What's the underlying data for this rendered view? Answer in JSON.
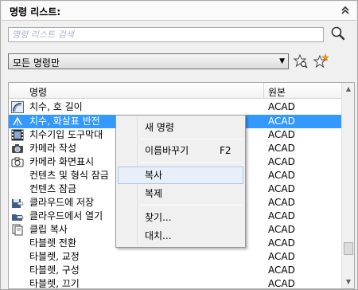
{
  "panel": {
    "title": "명령 리스트:",
    "collapse_icon": "double-chevron-up"
  },
  "search": {
    "placeholder": "명령 리스트 검색",
    "icon": "magnifier"
  },
  "filter": {
    "selected": "모든 명령만",
    "icons": [
      "find-star",
      "new-star"
    ]
  },
  "list": {
    "columns": [
      "명령",
      "원본"
    ],
    "rows": [
      {
        "name": "치수, 호 길이",
        "source": "ACAD",
        "icon": "arc-length"
      },
      {
        "name": "치수, 화살표 반전",
        "source": "ACAD",
        "icon": "flip-arrow",
        "selected": true
      },
      {
        "name": "치수기입 도구막대",
        "source": "ACAD",
        "icon": "film-strip"
      },
      {
        "name": "카메라 작성",
        "source": "ACAD",
        "icon": "camera"
      },
      {
        "name": "카메라 화면표시",
        "source": "ACAD",
        "icon": "camera"
      },
      {
        "name": "컨텐츠 및 형식 잠금",
        "source": "ACAD",
        "icon": ""
      },
      {
        "name": "컨텐츠 잠금",
        "source": "ACAD",
        "icon": ""
      },
      {
        "name": "클라우드에 저장",
        "source": "ACAD",
        "icon": "cloud-save"
      },
      {
        "name": "클라우드에서 열기",
        "source": "ACAD",
        "icon": "cloud-open"
      },
      {
        "name": "클립 복사",
        "source": "ACAD",
        "icon": "clip-copy"
      },
      {
        "name": "타블렛 전환",
        "source": "ACAD",
        "icon": ""
      },
      {
        "name": "타블렛, 교정",
        "source": "ACAD",
        "icon": ""
      },
      {
        "name": "타블렛, 구성",
        "source": "ACAD",
        "icon": ""
      },
      {
        "name": "타블렛, 끄기",
        "source": "ACAD",
        "icon": ""
      }
    ]
  },
  "context_menu": {
    "items": [
      {
        "label": "새 명령",
        "shortcut": ""
      },
      {
        "label": "이름바꾸기",
        "shortcut": "F2"
      },
      {
        "label": "복사",
        "shortcut": "",
        "hover": true
      },
      {
        "label": "복제",
        "shortcut": ""
      },
      {
        "label": "찾기...",
        "shortcut": ""
      },
      {
        "label": "대치...",
        "shortcut": ""
      }
    ]
  },
  "colors": {
    "selection": "#3399ff",
    "menu_hover": "#e8eff8"
  }
}
